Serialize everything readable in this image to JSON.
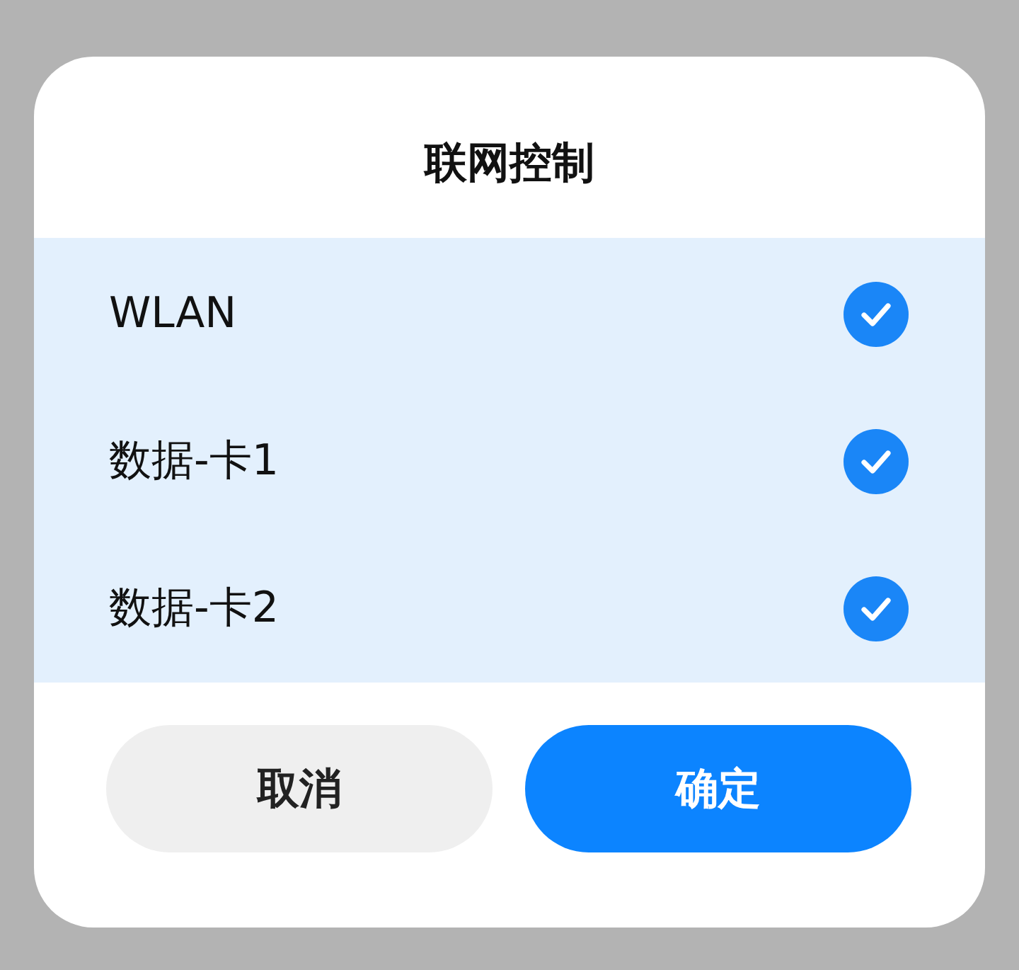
{
  "dialog": {
    "title": "联网控制"
  },
  "options": [
    {
      "label": "WLAN",
      "checked": true
    },
    {
      "label": "数据-卡1",
      "checked": true
    },
    {
      "label": "数据-卡2",
      "checked": true
    }
  ],
  "buttons": [
    {
      "label": "取消",
      "kind": "secondary"
    },
    {
      "label": "确定",
      "kind": "primary"
    }
  ]
}
